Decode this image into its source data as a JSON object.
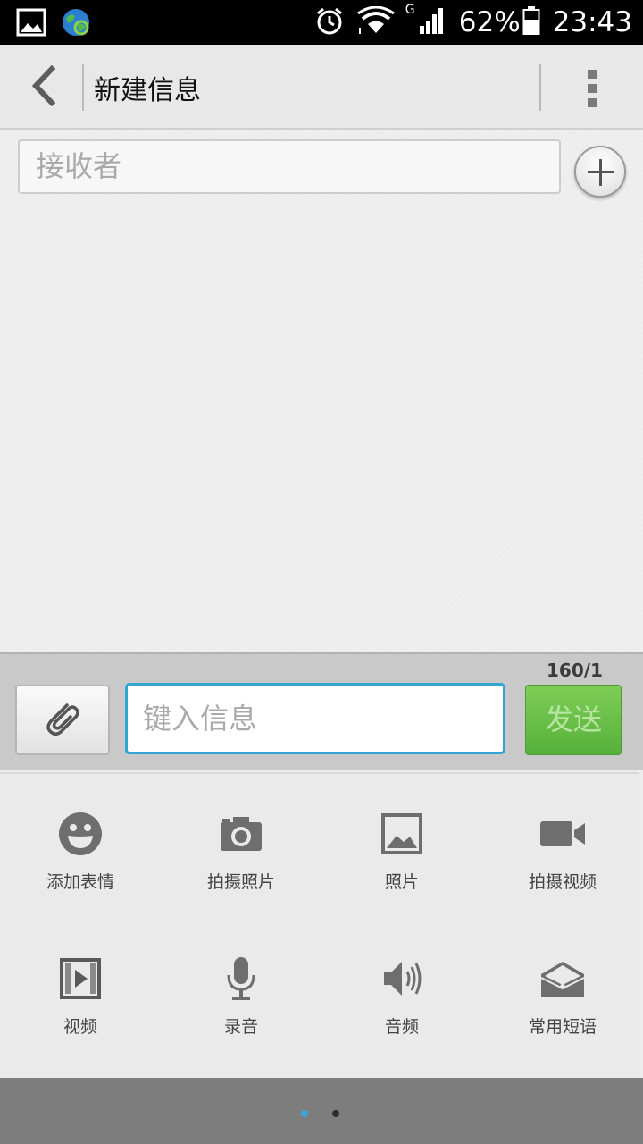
{
  "status_bar": {
    "battery": "62%",
    "time": "23:43",
    "network": "G",
    "icons": [
      "gallery-icon",
      "globe-sync-icon",
      "alarm-icon",
      "wifi-icon",
      "signal-icon",
      "battery-icon"
    ]
  },
  "action_bar": {
    "title": "新建信息",
    "icons": [
      "back-arrow-icon",
      "overflow-menu-icon"
    ]
  },
  "recipient": {
    "placeholder": "接收者",
    "add_icon": "plus-circle-icon"
  },
  "compose": {
    "counter": "160/1",
    "placeholder": "键入信息",
    "send_label": "发送",
    "attach_icon": "paperclip-icon"
  },
  "panel": {
    "items": [
      {
        "label": "添加表情",
        "icon": "smiley-icon"
      },
      {
        "label": "拍摄照片",
        "icon": "camera-icon"
      },
      {
        "label": "照片",
        "icon": "picture-icon"
      },
      {
        "label": "拍摄视频",
        "icon": "video-camera-icon"
      },
      {
        "label": "视频",
        "icon": "film-icon"
      },
      {
        "label": "录音",
        "icon": "microphone-icon"
      },
      {
        "label": "音频",
        "icon": "speaker-icon"
      },
      {
        "label": "常用短语",
        "icon": "envelope-icon"
      }
    ]
  },
  "pager": {
    "pages": 2,
    "active_page": 1,
    "colors": {
      "active": "#3aa6d8",
      "inactive": "#2e2e2e"
    }
  },
  "colors": {
    "send_button": "#66bd47",
    "input_focus": "#31a6d3"
  }
}
